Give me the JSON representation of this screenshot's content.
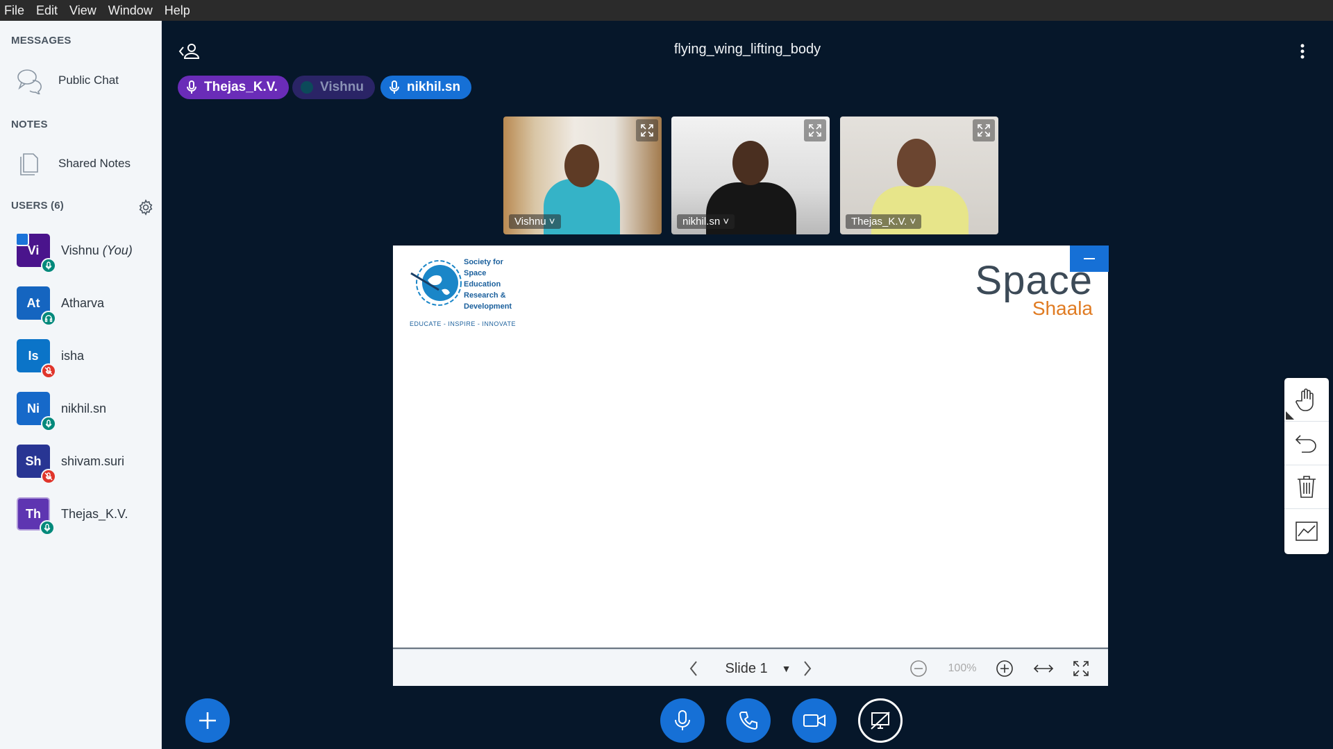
{
  "menubar": {
    "items": [
      "File",
      "Edit",
      "View",
      "Window",
      "Help"
    ]
  },
  "sidebar": {
    "messages_heading": "MESSAGES",
    "public_chat": "Public Chat",
    "notes_heading": "NOTES",
    "shared_notes": "Shared Notes",
    "users_heading": "USERS (6)",
    "users": [
      {
        "initials": "Vi",
        "name": "Vishnu",
        "suffix": "(You)",
        "color": "#4a148c",
        "status": "mic",
        "presenter": true
      },
      {
        "initials": "At",
        "name": "Atharva",
        "color": "#1565c0",
        "status": "listen"
      },
      {
        "initials": "Is",
        "name": "isha",
        "color": "#0b74c8",
        "status": "muted"
      },
      {
        "initials": "Ni",
        "name": "nikhil.sn",
        "color": "#1669c9",
        "status": "mic"
      },
      {
        "initials": "Sh",
        "name": "shivam.suri",
        "color": "#283593",
        "status": "muted"
      },
      {
        "initials": "Th",
        "name": "Thejas_K.V.",
        "color": "#5e35b1",
        "status": "mic"
      }
    ]
  },
  "meeting": {
    "title": "flying_wing_lifting_body"
  },
  "talkers": [
    {
      "name": "Thejas_K.V.",
      "bg": "#6a2cb8",
      "fg": "#ffffff",
      "state": "talking"
    },
    {
      "name": "Vishnu",
      "bg": "#2a2466",
      "fg": "#8a92b5",
      "state": "idle"
    },
    {
      "name": "nikhil.sn",
      "bg": "#1670d6",
      "fg": "#ffffff",
      "state": "talking"
    }
  ],
  "videos": [
    {
      "name": "Vishnu"
    },
    {
      "name": "nikhil.sn"
    },
    {
      "name": "Thejas_K.V."
    }
  ],
  "slide": {
    "logo_left_lines": [
      "Society for",
      "Space",
      "Education",
      "Research &",
      "Development"
    ],
    "logo_left_tagline": "EDUCATE - INSPIRE - INNOVATE",
    "logo_right_top": "Space",
    "logo_right_bottom": "Shaala",
    "slide_label": "Slide 1",
    "zoom": "100%"
  },
  "colors": {
    "accent": "#1670d6",
    "background": "#06172a",
    "sidebar": "#f3f6f9",
    "muted": "#e0352b",
    "mic": "#00897b"
  }
}
